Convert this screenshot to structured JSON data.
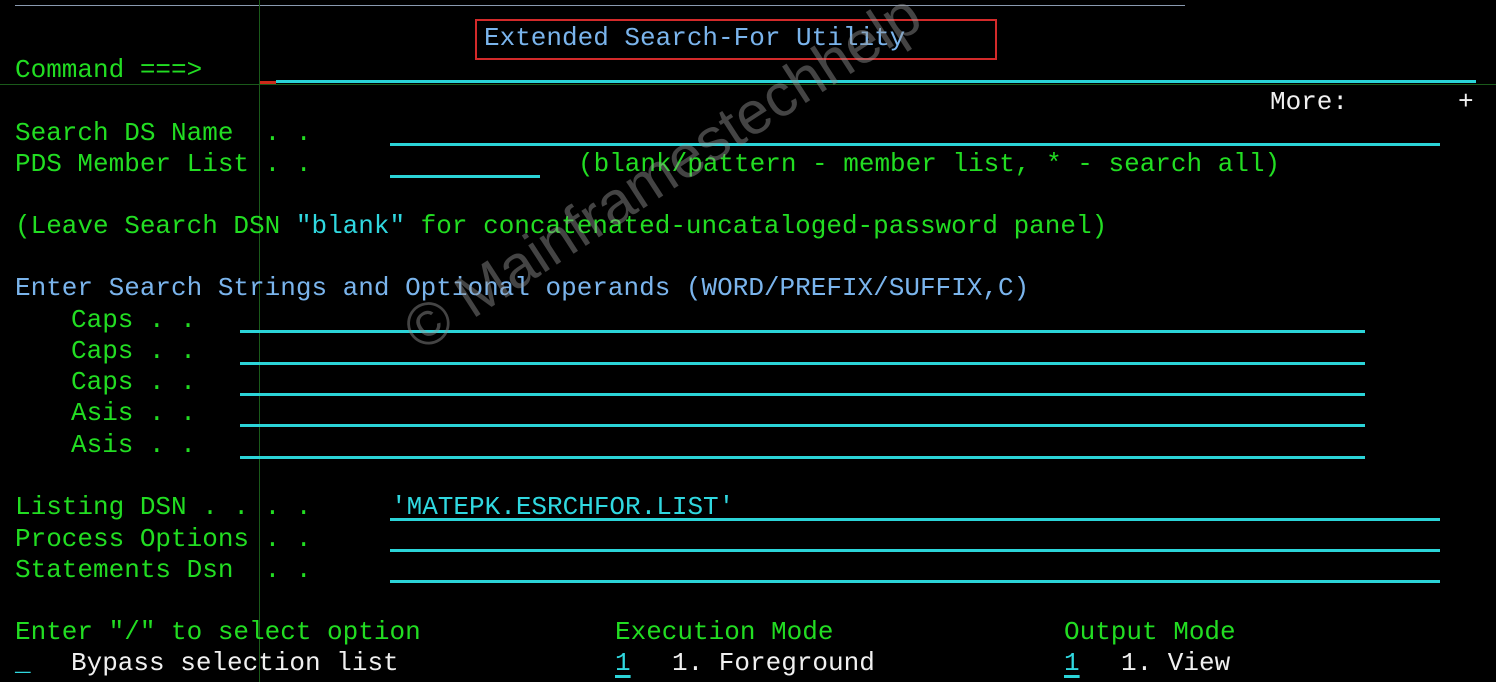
{
  "panel": {
    "title": "Extended Search-For Utility",
    "command_label": "Command ===>",
    "command_value": "",
    "more_label": "More:",
    "more_indicator": "+"
  },
  "dataset": {
    "search_ds_label": "Search DS Name  . .",
    "search_ds_value": "",
    "pds_member_label": "PDS Member List . .",
    "pds_member_value": "",
    "pds_member_hint": "(blank/pattern - member list, * - search all)",
    "leave_note_prefix": "(Leave Search DSN ",
    "leave_note_highlight": "\"blank\"",
    "leave_note_suffix": " for concatenated-uncataloged-password panel)"
  },
  "search_strings": {
    "heading": "Enter Search Strings and Optional operands (WORD/PREFIX/SUFFIX,C)",
    "rows": [
      {
        "label": "Caps . .",
        "value": ""
      },
      {
        "label": "Caps . .",
        "value": ""
      },
      {
        "label": "Caps . .",
        "value": ""
      },
      {
        "label": "Asis . .",
        "value": ""
      },
      {
        "label": "Asis . .",
        "value": ""
      }
    ]
  },
  "output": {
    "listing_dsn_label": "Listing DSN . . . .",
    "listing_dsn_value": "'MATEPK.ESRCHFOR.LIST'",
    "process_options_label": "Process Options . .",
    "process_options_value": "",
    "statements_dsn_label": "Statements Dsn  . .",
    "statements_dsn_value": ""
  },
  "options": {
    "select_heading": "Enter \"/\" to select option",
    "bypass_value": "_",
    "bypass_label": "Bypass selection list",
    "execution_heading": "Execution Mode",
    "execution_value": "1",
    "execution_option": "1. Foreground",
    "output_heading": "Output Mode",
    "output_value": "1",
    "output_option": "1. View"
  },
  "watermark": "© Mainframestechhelp",
  "colors": {
    "label_green": "#22dd22",
    "heading_blue": "#7ab4ec",
    "field_cyan": "#2bd4d8",
    "text_white": "#f0f0f0",
    "highlight_red": "#d32a2a"
  }
}
